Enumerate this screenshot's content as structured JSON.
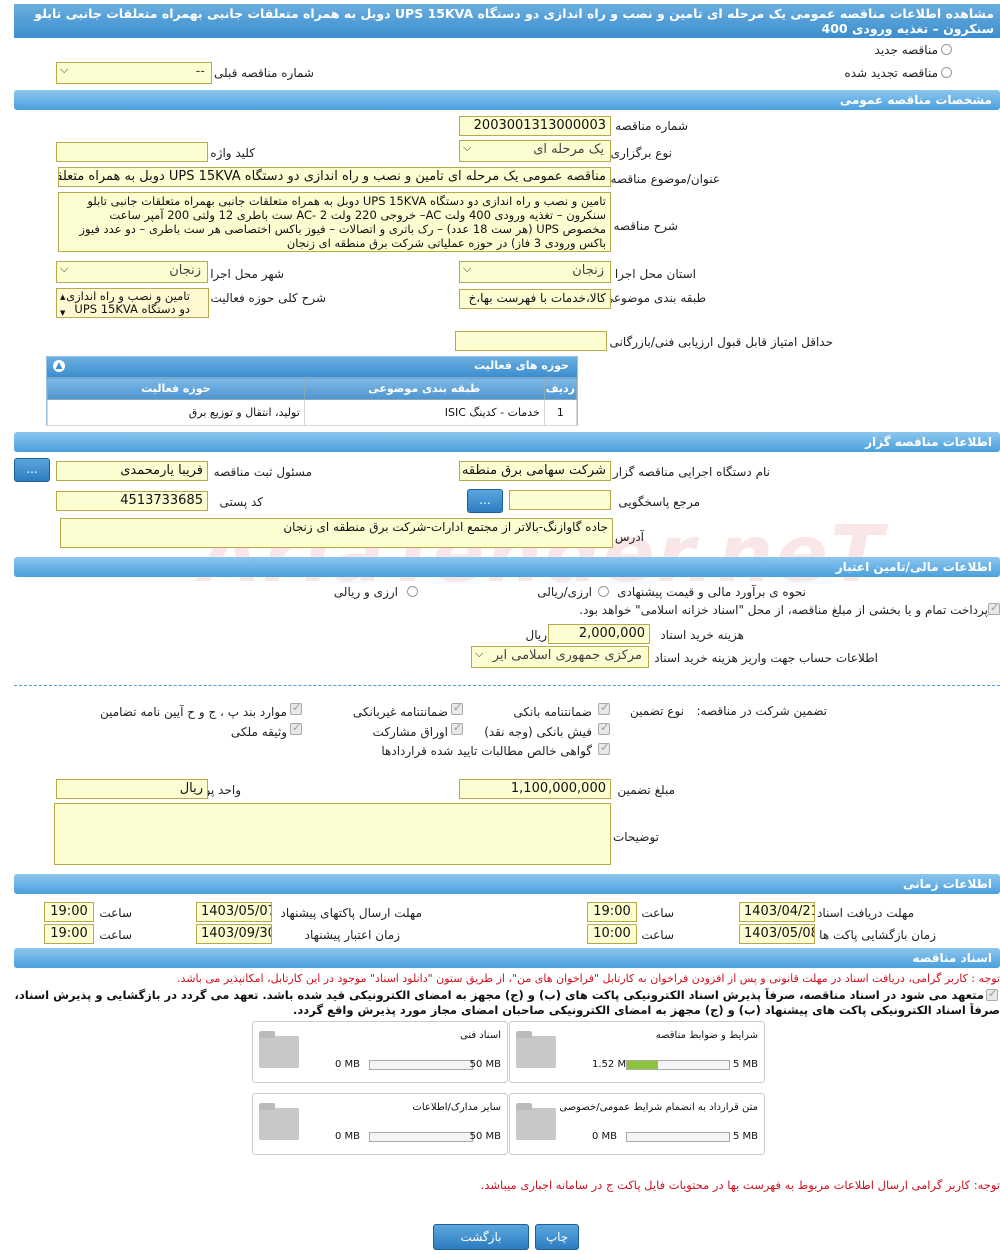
{
  "header": {
    "title": "مشاهده اطلاعات مناقصه عمومی یک مرحله ای تامین و نصب و راه اندازی دو دستگاه UPS 15KVA دوبل به همراه متعلقات جانبی بهمراه متعلقات جانبی تابلو سنکرون – تغذیه ورودی 400"
  },
  "tender_type": {
    "new_label": "مناقصه جدید",
    "renewed_label": "مناقصه تجدید شده",
    "prev_number_label": "شماره مناقصه قبلی",
    "prev_number_value": "--"
  },
  "general": {
    "section_title": "مشخصات مناقصه عمومی",
    "number_label": "شماره مناقصه",
    "number_value": "2003001313000003",
    "type_label": "نوع برگزاری",
    "type_value": "یک مرحله ای",
    "keyword_label": "کلید واژه",
    "keyword_value": "",
    "subject_label": "عنوان/موضوع مناقصه",
    "subject_value": "مناقصه عمومی یک مرحله ای تامین و نصب و راه اندازی دو دستگاه UPS 15KVA  دوبل به همراه متعلقات",
    "desc_label": "شرح مناقصه",
    "desc_value": "تامین و نصب و راه اندازی دو دستگاه UPS 15KVA  دوبل به همراه متعلقات جانبی بهمراه متعلقات جانبی تابلو سنکرون – تغذیه ورودی 400 ولت AC–  خروجی 220 ولت AC- 2 ست باطری 12 ولتی  200 آمپر ساعت مخصوص UPS (هر ست 18 عدد) – رک باتری و اتصالات – فیوز باکس اختصاصی هر ست باطری – دو عدد فیوز باکس ورودی 3 فاز) در حوزه عملیاتی شرکت برق منطقه ای زنجان",
    "province_label": "استان محل اجرا",
    "province_value": "زنجان",
    "city_label": "شهر محل اجرا",
    "city_value": "زنجان",
    "category_label": "طبقه بندی موضوعی",
    "category_value": "کالا،خدمات با فهرست بها،خ",
    "activity_label": "شرح کلی حوزه فعالیت",
    "activity_value": "تامین و نصب و راه اندازی دو دستگاه UPS 15KVA",
    "min_score_label": "حداقل امتیاز قابل قبول ارزیابی فنی/بازرگانی",
    "min_score_value": ""
  },
  "activity_table": {
    "title": "حوزه های فعالیت",
    "headers": [
      "ردیف",
      "طبقه بندی موضوعی",
      "حوزه فعالیت"
    ],
    "rows": [
      [
        "1",
        "خدمات - کدینگ ISIC",
        "تولید، انتقال و توزیع برق"
      ]
    ]
  },
  "organizer": {
    "section_title": "اطلاعات مناقصه گزار",
    "org_label": "نام دستگاه اجرایی مناقصه گزار",
    "org_value": "شرکت سهامی برق منطقه",
    "responsible_label": "مسئول ثبت مناقصه",
    "responsible_value": "فریبا یارمحمدی",
    "ref_label": "مرجع پاسخگویی",
    "ref_value": "",
    "postal_label": "کد پستی",
    "postal_value": "4513733685",
    "address_label": "آدرس",
    "address_value": "جاده گاوازنگ-بالاتر از مجتمع ادارات-شرکت برق منطقه ای زنجان",
    "more_btn": "..."
  },
  "finance": {
    "section_title": "اطلاعات مالی/تامین اعتبار",
    "estimate_label": "نحوه ی برآورد مالی و قیمت پیشنهادی",
    "opt_fx": "ارزی/ریالی",
    "opt_rial": "ارزی و ریالی",
    "treasury_text": "پرداخت تمام و یا بخشی از مبلغ مناقصه، از محل \"اسناد خزانه اسلامی\" خواهد بود.",
    "doc_price_label": "هزینه خرید اسناد",
    "doc_price_value": "2,000,000",
    "doc_price_unit": "ریال",
    "account_label": "اطلاعات حساب جهت واریز هزینه خرید اسناد",
    "account_value": "مرکزی جمهوری اسلامی ایر"
  },
  "guarantee": {
    "label": "تضمین شرکت در مناقصه:",
    "type_label": "نوع تضمین",
    "opt_bank_guarantee": "ضمانتنامه بانکی",
    "opt_nonbank": "ضمانتنامه غیربانکی",
    "opt_clauses": "موارد بند پ ، ج و ح آیین نامه تضامین",
    "opt_receipt": "فیش بانکی (وجه نقد)",
    "opt_bonds": "اوراق مشارکت",
    "opt_property": "وثیقه ملکی",
    "opt_claims": "گواهی خالص مطالبات تایید شده قراردادها",
    "amount_label": "مبلغ تضمین",
    "amount_value": "1,100,000,000",
    "currency_label": "واحد پول",
    "currency_value": "ریال",
    "notes_label": "توضیحات",
    "notes_value": ""
  },
  "timing": {
    "section_title": "اطلاعات زمانی",
    "receive_label": "مهلت دریافت اسناد",
    "receive_date": "1403/04/21",
    "receive_time": "19:00",
    "send_label": "مهلت ارسال پاکتهای پیشنهاد",
    "send_date": "1403/05/07",
    "send_time": "19:00",
    "open_label": "زمان بازگشایی پاکت ها",
    "open_date": "1403/05/08",
    "open_time": "10:00",
    "validity_label": "زمان اعتبار پیشنهاد",
    "validity_date": "1403/09/30",
    "validity_time": "19:00",
    "time_label": "ساعت"
  },
  "docs": {
    "section_title": "اسناد مناقصه",
    "notice_red": "توجه : کاربر گرامی، دریافت اسناد در مهلت قانونی و پس از افزودن فراخوان به کارتابل \"فراخوان های من\"، از طریق ستون \"دانلود اسناد\" موجود در این کارتابل، امکانپذیر می باشد.",
    "commit_line1": "متعهد می شود در اسناد مناقصه، صرفاً پذیرش اسناد الکترونیکی پاکت های (ب) و (ج) مجهز به امضای الکترونیکی قید شده باشد. تعهد می گردد در بازگشایی و پذیرش اسناد،",
    "commit_line2": "صرفاً اسناد الکترونیکی پاکت های پیشنهاد (ب) و (ج) مجهز به امضای الکترونیکی صاحبان امضای مجاز مورد پذیرش واقع گردد.",
    "files": [
      {
        "title": "شرایط و ضوابط مناقصه",
        "current": "1.52 MB",
        "max": "5 MB",
        "fill": 0.3
      },
      {
        "title": "اسناد فنی",
        "current": "0 MB",
        "max": "50 MB",
        "fill": 0
      },
      {
        "title": "متن قرارداد به انضمام شرایط عمومی/خصوصی",
        "current": "0 MB",
        "max": "5 MB",
        "fill": 0
      },
      {
        "title": "سایر مدارک/اطلاعات",
        "current": "0 MB",
        "max": "50 MB",
        "fill": 0
      }
    ],
    "price_note": "توجه: کاربر گرامی ارسال اطلاعات مربوط به فهرست بها در محتویات فایل پاکت ج در سامانه اجباری میباشد."
  },
  "footer": {
    "print_btn": "چاپ",
    "back_btn": "بازگشت"
  },
  "watermark": "AriaTender.neT",
  "colors": {
    "section": "#4aa0dc",
    "input_bg": "#fdfdd2",
    "notice_red": "#d0101f",
    "progress": "#8cc43c"
  }
}
